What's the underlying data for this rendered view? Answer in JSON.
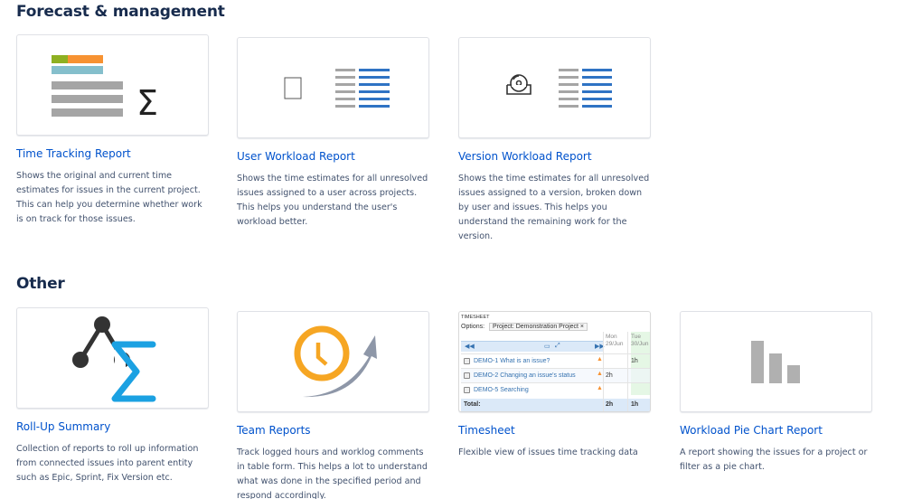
{
  "sections": [
    {
      "title": "Forecast & management",
      "reports": [
        {
          "title": "Time Tracking Report",
          "icon": "time-tracking-sigma-icon",
          "description": "Shows the original and current time estimates for issues in the current project. This can help you determine whether work is on track for those issues."
        },
        {
          "title": "User Workload Report",
          "icon": "user-workload-icon",
          "description": "Shows the time estimates for all unresolved issues assigned to a user across projects. This helps you understand the user's workload better."
        },
        {
          "title": "Version Workload Report",
          "icon": "version-workload-icon",
          "description": "Shows the time estimates for all unresolved issues assigned to a version, broken down by user and issues. This helps you understand the remaining work for the version."
        }
      ]
    },
    {
      "title": "Other",
      "reports": [
        {
          "title": "Roll-Up Summary",
          "icon": "rollup-sigma-icon",
          "description": "Collection of reports to roll up information from connected issues into parent entity such as Epic, Sprint, Fix Version etc."
        },
        {
          "title": "Team Reports",
          "icon": "clock-arrow-icon",
          "description": "Track logged hours and worklog comments in table form. This helps a lot to understand what was done in the specified period and respond accordingly."
        },
        {
          "title": "Timesheet",
          "icon": "timesheet-preview",
          "description": "Flexible view of issues time tracking data",
          "preview": {
            "header": "TIMESHEET",
            "options_label": "Options:",
            "options_chip": "Project: Demonstration Project ×",
            "days": [
              {
                "name": "Mon",
                "date": "29/Jun"
              },
              {
                "name": "Tue",
                "date": "30/Jun"
              }
            ],
            "rows": [
              {
                "key": "DEMO-1",
                "summary": "What is an issue?",
                "mon": "",
                "tue": "1h"
              },
              {
                "key": "DEMO-2",
                "summary": "Changing an issue's status",
                "mon": "2h",
                "tue": ""
              },
              {
                "key": "DEMO-5",
                "summary": "Searching",
                "mon": "",
                "tue": ""
              }
            ],
            "total_label": "Total:",
            "total_mon": "2h",
            "total_tue": "1h"
          }
        },
        {
          "title": "Workload Pie Chart Report",
          "icon": "bar-chart-icon",
          "description": "A report showing the issues for a project or filter as a pie chart."
        }
      ]
    }
  ],
  "colors": {
    "link": "#0052cc",
    "heading": "#172b4d",
    "text": "#42526e",
    "sigma_blue": "#1ba1e2",
    "clock_orange": "#f6a623"
  }
}
